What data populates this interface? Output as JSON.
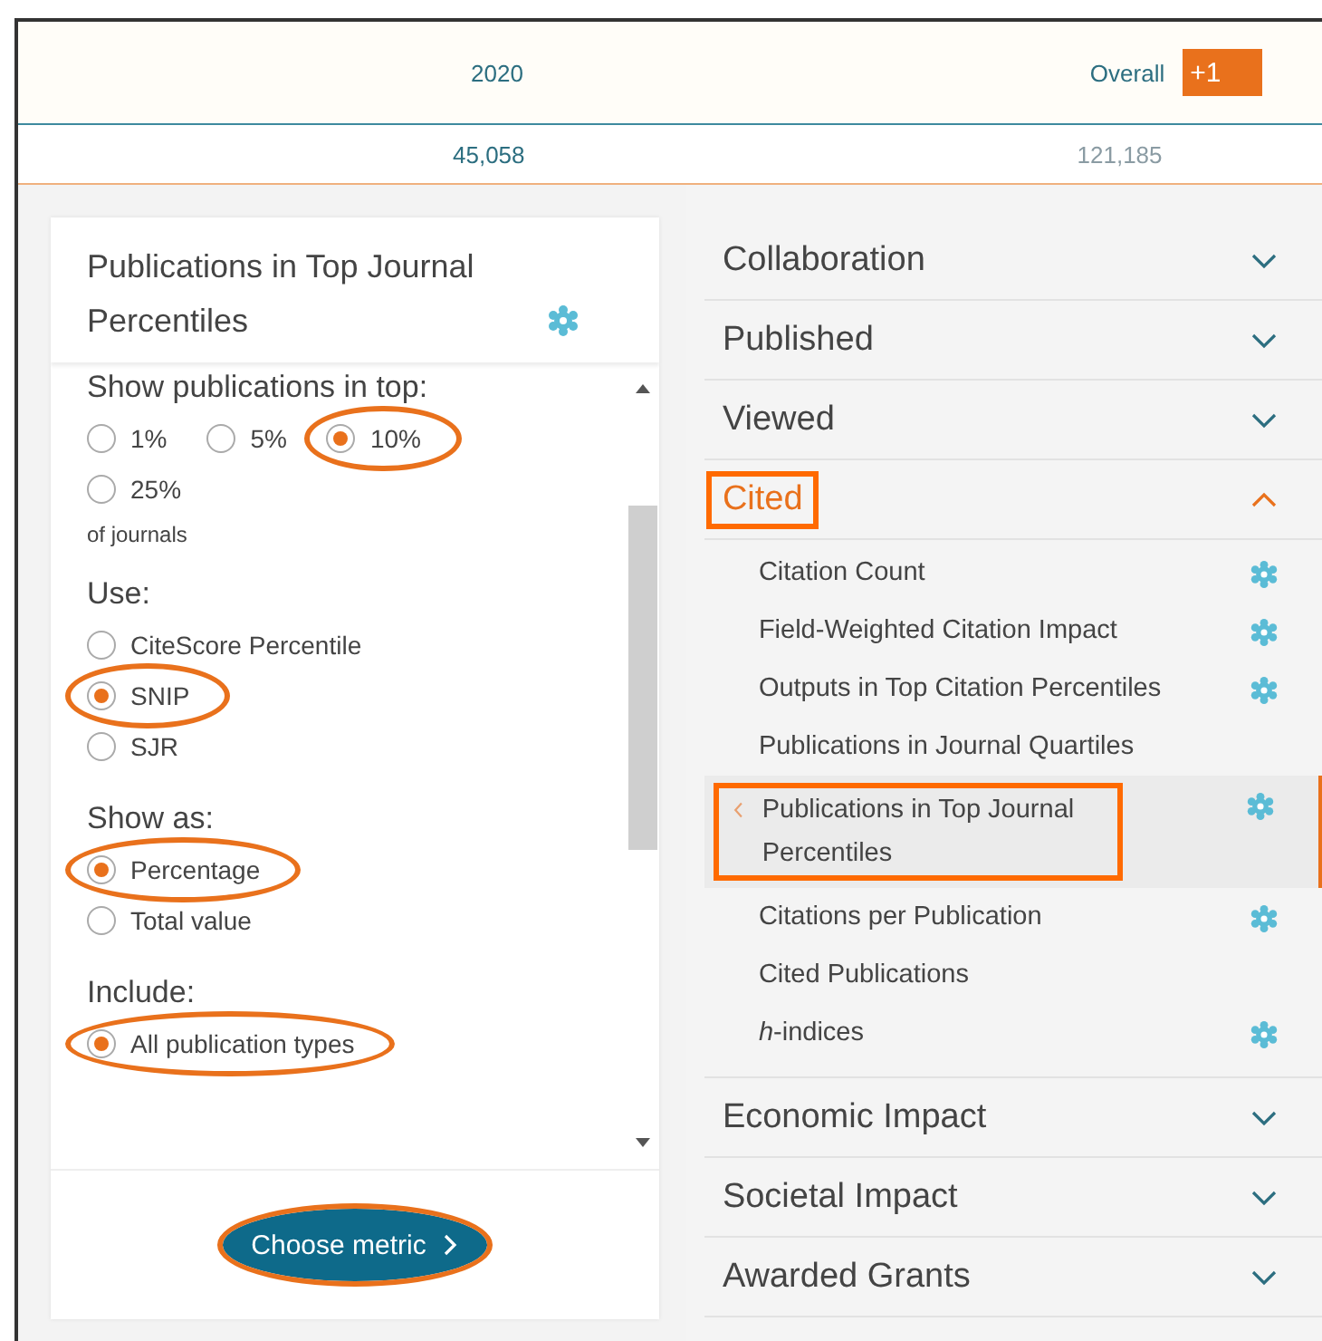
{
  "header": {
    "columns": [
      "2020",
      "Overall"
    ],
    "add_button": "+1"
  },
  "values": [
    {
      "text": "45,058",
      "faded": false
    },
    {
      "text": "121,185",
      "faded": true
    }
  ],
  "panel": {
    "title": "Publications in Top Journal Percentiles",
    "groups": [
      {
        "label": "Show publications in top:",
        "inline": true,
        "note": "of journals",
        "options": [
          {
            "label": "1%",
            "selected": false,
            "highlighted": false
          },
          {
            "label": "5%",
            "selected": false,
            "highlighted": false
          },
          {
            "label": "10%",
            "selected": true,
            "highlighted": true
          },
          {
            "label": "25%",
            "selected": false,
            "highlighted": false
          }
        ]
      },
      {
        "label": "Use:",
        "inline": false,
        "options": [
          {
            "label": "CiteScore Percentile",
            "selected": false,
            "highlighted": false
          },
          {
            "label": "SNIP",
            "selected": true,
            "highlighted": true
          },
          {
            "label": "SJR",
            "selected": false,
            "highlighted": false
          }
        ]
      },
      {
        "label": "Show as:",
        "inline": false,
        "options": [
          {
            "label": "Percentage",
            "selected": true,
            "highlighted": true
          },
          {
            "label": "Total value",
            "selected": false,
            "highlighted": false
          }
        ]
      },
      {
        "label": "Include:",
        "inline": false,
        "options": [
          {
            "label": "All publication types",
            "selected": true,
            "highlighted": true
          }
        ]
      }
    ],
    "button": {
      "label": "Choose metric",
      "highlighted": true
    }
  },
  "menu": [
    {
      "label": "Collaboration",
      "expanded": false,
      "highlighted": false
    },
    {
      "label": "Published",
      "expanded": false,
      "highlighted": false
    },
    {
      "label": "Viewed",
      "expanded": false,
      "highlighted": false
    },
    {
      "label": "Cited",
      "expanded": true,
      "highlighted": true,
      "children": [
        {
          "label": "Citation Count",
          "info": true,
          "selected": false,
          "highlighted": false
        },
        {
          "label": "Field-Weighted Citation Impact",
          "info": true,
          "selected": false,
          "highlighted": false
        },
        {
          "label": "Outputs in Top Citation Percentiles",
          "info": true,
          "selected": false,
          "highlighted": false
        },
        {
          "label": "Publications in Journal Quartiles",
          "info": false,
          "selected": false,
          "highlighted": false
        },
        {
          "label": "Publications in Top Journal Percentiles",
          "info": true,
          "selected": true,
          "highlighted": true
        },
        {
          "label": "Citations per Publication",
          "info": true,
          "selected": false,
          "highlighted": false
        },
        {
          "label": "Cited Publications",
          "info": false,
          "selected": false,
          "highlighted": false
        },
        {
          "label": "*h*-indices",
          "info": true,
          "selected": false,
          "highlighted": false
        }
      ]
    },
    {
      "label": "Economic Impact",
      "expanded": false,
      "highlighted": false
    },
    {
      "label": "Societal Impact",
      "expanded": false,
      "highlighted": false
    },
    {
      "label": "Awarded Grants",
      "expanded": false,
      "highlighted": false
    }
  ]
}
